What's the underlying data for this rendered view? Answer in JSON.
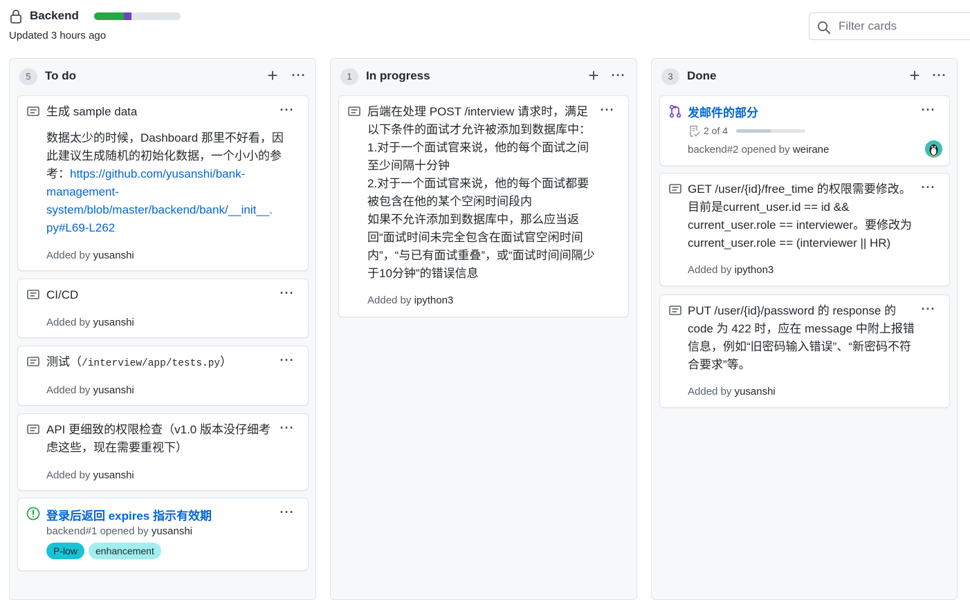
{
  "header": {
    "board_title": "Backend",
    "updated": "Updated 3 hours ago",
    "progress": {
      "done_fraction": 0.34,
      "in_progress_fraction": 0.09,
      "done_color": "#28a745",
      "in_progress_color": "#6f42c1"
    },
    "filter_placeholder": "Filter cards"
  },
  "columns": [
    {
      "count": "5",
      "title": "To do",
      "cards": [
        {
          "type": "note",
          "title": "生成 sample data",
          "body": "数据太少的时候，Dashboard 那里不好看，因此建议生成随机的初始化数据，一个小小的参考：",
          "link_lines": [
            "https://github.com/yusanshi/bank-",
            "management-",
            "system/blob/master/backend/bank/__init__.",
            "py#L69-L262"
          ],
          "added_prefix": "Added by",
          "added_user": "yusanshi"
        },
        {
          "type": "note",
          "title": "CI/CD",
          "added_prefix": "Added by",
          "added_user": "yusanshi"
        },
        {
          "type": "note",
          "title_prefix": "测试（",
          "title_code": "/interview/app/tests.py",
          "title_suffix": "）",
          "added_prefix": "Added by",
          "added_user": "yusanshi"
        },
        {
          "type": "note",
          "title": "API 更细致的权限检查（v1.0 版本没仔细考虑这些，现在需要重视下）",
          "added_prefix": "Added by",
          "added_user": "yusanshi"
        },
        {
          "type": "issue",
          "title": "登录后返回 expires 指示有效期",
          "meta_prefix": "backend#1 opened by",
          "meta_user": "yusanshi",
          "labels": [
            {
              "name": "P-low",
              "color": "#17c3d6"
            },
            {
              "name": "enhancement",
              "color": "#a2eeef"
            }
          ]
        }
      ]
    },
    {
      "count": "1",
      "title": "In progress",
      "cards": [
        {
          "type": "note",
          "lines": [
            "后端在处理 POST /interview 请求时，满足",
            "以下条件的面试才允许被添加到数据库中：",
            "1.对于一个面试官来说，他的每个面试之间",
            "至少间隔十分钟",
            "2.对于一个面试官来说，他的每个面试都要",
            "被包含在他的某个空闲时间段内",
            "如果不允许添加到数据库中，那么应当返",
            "回“面试时间未完全包含在面试官空闲时间",
            "内”，“与已有面试重叠”，或“面试时间间隔少",
            "于10分钟”的错误信息"
          ],
          "added_prefix": "Added by",
          "added_user": "ipython3"
        }
      ]
    },
    {
      "count": "3",
      "title": "Done",
      "cards": [
        {
          "type": "pull_request",
          "title": "发邮件的部分",
          "checklist": "2 of 4",
          "checklist_fraction": 0.5,
          "meta_prefix": "backend#2 opened by",
          "meta_user": "weirane",
          "avatar": "penguin-avatar"
        },
        {
          "type": "note",
          "lines": [
            "GET /user/{id}/free_time 的权限需要修改。",
            "目前是current_user.id == id &&",
            "current_user.role == interviewer。要修改为",
            "current_user.role == (interviewer || HR)"
          ],
          "added_prefix": "Added by",
          "added_user": "ipython3"
        },
        {
          "type": "note",
          "lines": [
            "PUT /user/{id}/password 的 response 的",
            "code 为 422 时，应在 message 中附上报错",
            "信息，例如“旧密码输入错误”、“新密码不符",
            "合要求”等。"
          ],
          "added_prefix": "Added by",
          "added_user": "yusanshi"
        }
      ]
    }
  ]
}
